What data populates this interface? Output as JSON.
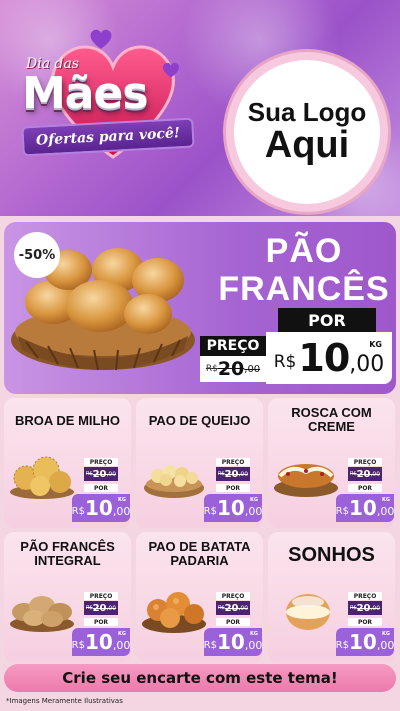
{
  "header": {
    "dia_das": "Dia das",
    "maes": "Mães",
    "subtitle": "Ofertas para você!",
    "logo_line1": "Sua Logo",
    "logo_line2": "Aqui"
  },
  "featured": {
    "discount": "-50%",
    "title_line1": "PÃO",
    "title_line2": "FRANCÊS",
    "preco_label": "PREÇO",
    "old_currency": "R$",
    "old_value": "20",
    "old_cents": ",00",
    "por_label": "POR",
    "new_currency": "R$",
    "new_value": "10",
    "new_cents": ",00",
    "unit": "KG"
  },
  "products": [
    {
      "name": "BROA DE MILHO",
      "preco_label": "PREÇO",
      "old_currency": "R$",
      "old_value": "20",
      "old_cents": ",00",
      "por_label": "POR",
      "new_currency": "R$",
      "new_value": "10",
      "new_cents": ",00",
      "unit": "KG",
      "icon": "broa-icon"
    },
    {
      "name": "PAO DE QUEIJO",
      "preco_label": "PREÇO",
      "old_currency": "R$",
      "old_value": "20",
      "old_cents": ",00",
      "por_label": "POR",
      "new_currency": "R$",
      "new_value": "10",
      "new_cents": ",00",
      "unit": "KG",
      "icon": "pao-de-queijo-icon"
    },
    {
      "name": "ROSCA COM CREME",
      "preco_label": "PREÇO",
      "old_currency": "R$",
      "old_value": "20",
      "old_cents": ",00",
      "por_label": "POR",
      "new_currency": "R$",
      "new_value": "10",
      "new_cents": ",00",
      "unit": "KG",
      "icon": "rosca-icon"
    },
    {
      "name": "PÃO FRANCÊS INTEGRAL",
      "preco_label": "PREÇO",
      "old_currency": "R$",
      "old_value": "20",
      "old_cents": ",00",
      "por_label": "POR",
      "new_currency": "R$",
      "new_value": "10",
      "new_cents": ",00",
      "unit": "KG",
      "icon": "pao-integral-icon"
    },
    {
      "name": "PAO DE BATATA PADARIA",
      "preco_label": "PREÇO",
      "old_currency": "R$",
      "old_value": "20",
      "old_cents": ",00",
      "por_label": "POR",
      "new_currency": "R$",
      "new_value": "10",
      "new_cents": ",00",
      "unit": "KG",
      "icon": "pao-de-batata-icon"
    },
    {
      "name": "SONHOS",
      "preco_label": "PREÇO",
      "old_currency": "R$",
      "old_value": "20",
      "old_cents": ",00",
      "por_label": "POR",
      "new_currency": "R$",
      "new_value": "10",
      "new_cents": ",00",
      "unit": "KG",
      "icon": "sonho-icon"
    }
  ],
  "footer": {
    "cta": "Crie seu encarte com este tema!",
    "disclaimer": "*Imagens Meramente Ilustrativas"
  },
  "colors": {
    "header_purple": "#b46ad0",
    "featured_purple": "#a564d2",
    "price_purple": "#9a61d8",
    "old_price_dark": "#4b2371",
    "card_pink": "#f6cfe0",
    "cta_pink": "#ec7aab"
  }
}
